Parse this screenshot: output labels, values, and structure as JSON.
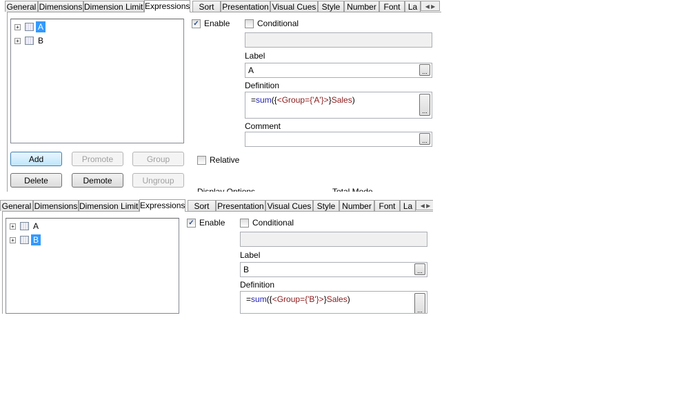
{
  "tabs": [
    "General",
    "Dimensions",
    "Dimension Limits",
    "Expressions",
    "Sort",
    "Presentation",
    "Visual Cues",
    "Style",
    "Number",
    "Font",
    "La"
  ],
  "selected_tab": "Expressions",
  "buttons": {
    "add": "Add",
    "promote": "Promote",
    "group": "Group",
    "delete": "Delete",
    "demote": "Demote",
    "ungroup": "Ungroup"
  },
  "labels": {
    "enable": "Enable",
    "conditional": "Conditional",
    "label": "Label",
    "definition": "Definition",
    "comment": "Comment",
    "relative": "Relative",
    "display_options": "Display Options",
    "total_mode": "Total Mode",
    "ellipsis": "..."
  },
  "panels": [
    {
      "tree": [
        {
          "label": "A",
          "selected": true
        },
        {
          "label": "B",
          "selected": false
        }
      ],
      "enable": true,
      "conditional": false,
      "label_value": "A",
      "definition": {
        "prefix": "=",
        "func": "sum",
        "open": "({",
        "set": "<Group={'A'}>",
        "close": "}",
        "field": "Sales",
        "end": ")"
      },
      "comment": ""
    },
    {
      "tree": [
        {
          "label": "A",
          "selected": false
        },
        {
          "label": "B",
          "selected": true
        }
      ],
      "enable": true,
      "conditional": false,
      "label_value": "B",
      "definition": {
        "prefix": "=",
        "func": "sum",
        "open": "({",
        "set": "<Group={'B'}>",
        "close": "}",
        "field": "Sales",
        "end": ")"
      }
    }
  ]
}
